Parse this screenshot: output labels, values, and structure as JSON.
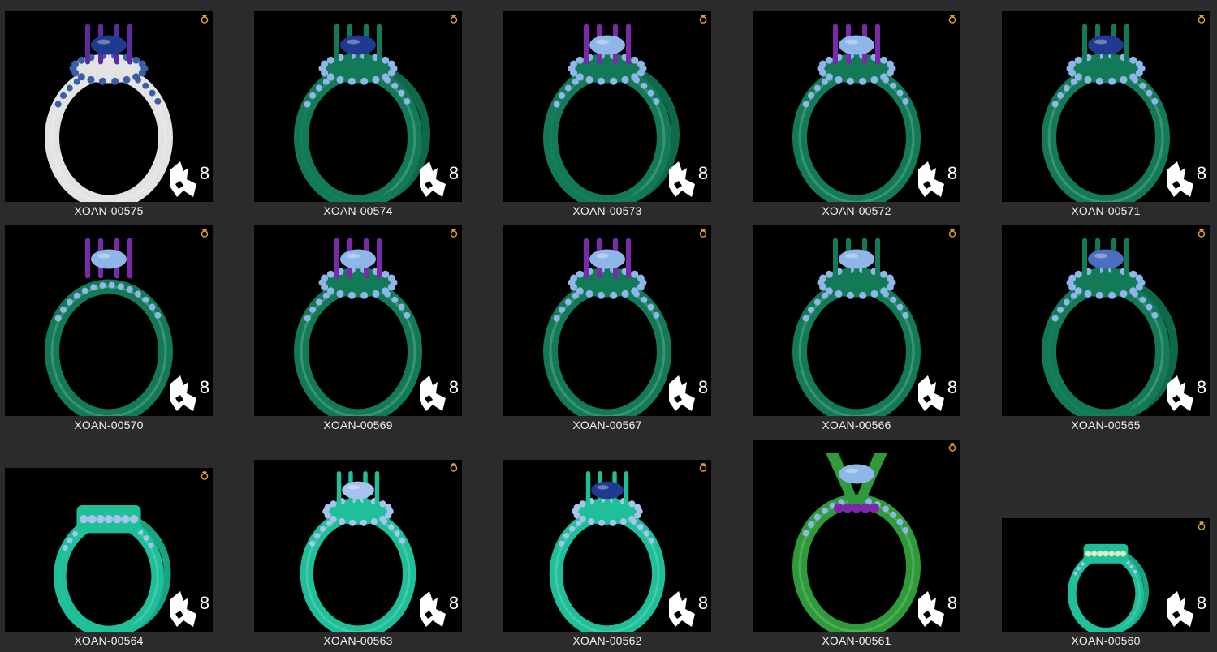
{
  "gallery": {
    "items": [
      {
        "label": "XOAN-00575",
        "metal": "#e3e3e3",
        "accent": "#5b2d9c",
        "stone": "#1f3a8f",
        "stones": "#3a5fa8",
        "style": "halo"
      },
      {
        "label": "XOAN-00574",
        "metal": "#137a58",
        "accent": "#137a58",
        "stone": "#1f3a8f",
        "stones": "#8fb6e8",
        "style": "split"
      },
      {
        "label": "XOAN-00573",
        "metal": "#137a58",
        "accent": "#7a2aa8",
        "stone": "#8fb6e8",
        "stones": "#8fb6e8",
        "style": "split"
      },
      {
        "label": "XOAN-00572",
        "metal": "#137a58",
        "accent": "#7a2aa8",
        "stone": "#8fb6e8",
        "stones": "#8fb6e8",
        "style": "halo"
      },
      {
        "label": "XOAN-00571",
        "metal": "#137a58",
        "accent": "#137a58",
        "stone": "#1f3a8f",
        "stones": "#8fb6e8",
        "style": "halo"
      },
      {
        "label": "XOAN-00570",
        "metal": "#137a58",
        "accent": "#7a2aa8",
        "stone": "#8fb6e8",
        "stones": "#8fb6e8",
        "style": "solitaire"
      },
      {
        "label": "XOAN-00569",
        "metal": "#137a58",
        "accent": "#7a2aa8",
        "stone": "#8fb6e8",
        "stones": "#8fb6e8",
        "style": "halo"
      },
      {
        "label": "XOAN-00567",
        "metal": "#137a58",
        "accent": "#7a2aa8",
        "stone": "#8fb6e8",
        "stones": "#8fb6e8",
        "style": "halo"
      },
      {
        "label": "XOAN-00566",
        "metal": "#137a58",
        "accent": "#137a58",
        "stone": "#8fb6e8",
        "stones": "#8fb6e8",
        "style": "halo"
      },
      {
        "label": "XOAN-00565",
        "metal": "#137a58",
        "accent": "#137a58",
        "stone": "#4a6fc0",
        "stones": "#8fb6e8",
        "style": "split"
      },
      {
        "label": "XOAN-00564",
        "metal": "#1fbf9a",
        "accent": "#1fbf9a",
        "stone": "#a8c4ee",
        "stones": "#a8c4ee",
        "style": "band"
      },
      {
        "label": "XOAN-00563",
        "metal": "#1fbf9a",
        "accent": "#1fbf9a",
        "stone": "#a8c4ee",
        "stones": "#a8c4ee",
        "style": "halo"
      },
      {
        "label": "XOAN-00562",
        "metal": "#1fbf9a",
        "accent": "#1fbf9a",
        "stone": "#1f3a8f",
        "stones": "#a8c4ee",
        "style": "halo"
      },
      {
        "label": "XOAN-00561",
        "metal": "#2e9a3a",
        "accent": "#7a2aa8",
        "stone": "#8fb6e8",
        "stones": "#8fb6e8",
        "style": "v-prong"
      },
      {
        "label": "XOAN-00560",
        "metal": "#1fbf9a",
        "accent": "#1fbf9a",
        "stone": "#dfe9c8",
        "stones": "#a8c4ee",
        "style": "band"
      }
    ]
  }
}
